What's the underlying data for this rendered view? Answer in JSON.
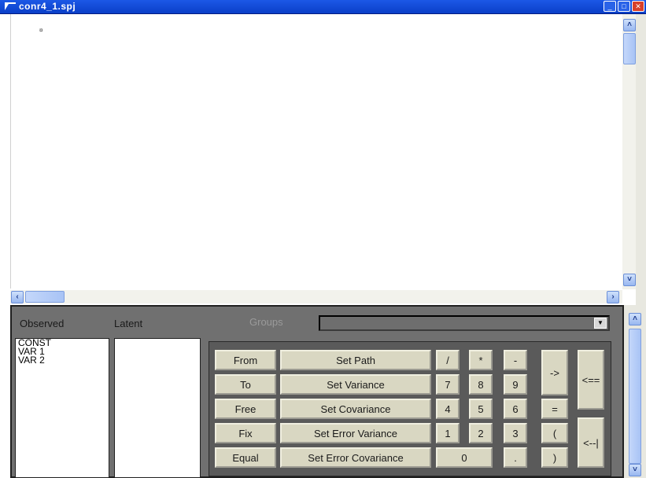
{
  "window": {
    "title": "conr4_1.spj"
  },
  "canvas": {
    "mark": "¤"
  },
  "panel": {
    "observed_label": "Observed",
    "latent_label": "Latent",
    "groups_label": "Groups",
    "groups_value": "",
    "observed_items": [
      "CONST",
      "VAR 1",
      "VAR 2"
    ],
    "buttons": {
      "from": "From",
      "to": "To",
      "free": "Free",
      "fix": "Fix",
      "equal": "Equal",
      "set_path": "Set Path",
      "set_variance": "Set Variance",
      "set_covariance": "Set Covariance",
      "set_error_variance": "Set Error Variance",
      "set_error_covariance": "Set Error Covariance",
      "slash": "/",
      "star": "*",
      "minus": "-",
      "seven": "7",
      "eight": "8",
      "nine": "9",
      "four": "4",
      "five": "5",
      "six": "6",
      "one": "1",
      "two": "2",
      "three": "3",
      "zero": "0",
      "dot": ".",
      "arrow_right": "->",
      "equals": "=",
      "paren_open": "(",
      "paren_close": ")",
      "arrow_left_double": "<==",
      "arrow_left_single": "<--|"
    }
  }
}
